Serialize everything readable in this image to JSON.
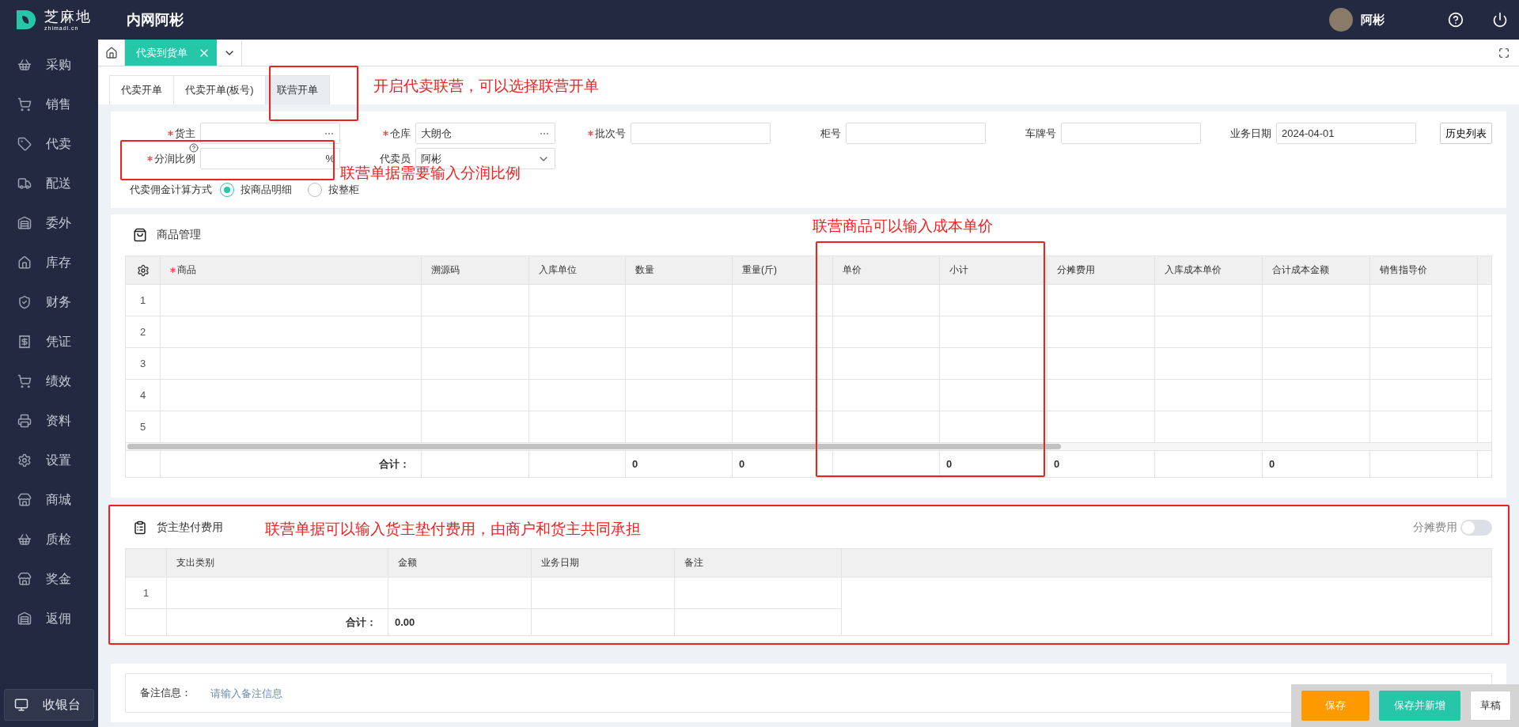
{
  "header": {
    "logo_text": "芝麻地",
    "logo_subtext": "zhimadi.cn",
    "title": "内网阿彬",
    "user": "阿彬"
  },
  "sidebar": {
    "items": [
      {
        "label": "采购"
      },
      {
        "label": "销售"
      },
      {
        "label": "代卖"
      },
      {
        "label": "配送"
      },
      {
        "label": "委外"
      },
      {
        "label": "库存"
      },
      {
        "label": "财务"
      },
      {
        "label": "凭证"
      },
      {
        "label": "绩效"
      },
      {
        "label": "资料"
      },
      {
        "label": "设置"
      },
      {
        "label": "商城"
      },
      {
        "label": "质检"
      },
      {
        "label": "奖金"
      },
      {
        "label": "返佣"
      }
    ],
    "cashier": "收银台"
  },
  "page_tabs": [
    {
      "label": "代卖到货单",
      "selected": true
    }
  ],
  "order_tabs": [
    {
      "label": "代卖开单",
      "selected": false
    },
    {
      "label": "代卖开单(板号)",
      "selected": false
    },
    {
      "label": "联营开单",
      "selected": true
    }
  ],
  "form": {
    "fields": [
      {
        "label": "货主",
        "required": true,
        "kind": "picker"
      },
      {
        "label": "仓库",
        "required": true,
        "kind": "picker",
        "value": "大朗仓"
      },
      {
        "label": "批次号",
        "required": true,
        "kind": "text"
      },
      {
        "label": "柜号",
        "required": false,
        "kind": "text"
      },
      {
        "label": "车牌号",
        "required": false,
        "kind": "text"
      },
      {
        "label": "业务日期",
        "required": false,
        "kind": "text",
        "value": "2024-04-01"
      },
      {
        "label": "分润比例",
        "required": true,
        "kind": "percent",
        "suffix": "%"
      },
      {
        "label": "代卖员",
        "required": false,
        "kind": "select",
        "value": "阿彬"
      }
    ],
    "history_button": "历史列表",
    "commission": {
      "label": "代卖佣金计算方式",
      "options": [
        {
          "label": "按商品明细",
          "selected": true
        },
        {
          "label": "按整柜",
          "selected": false
        }
      ]
    }
  },
  "goods": {
    "title": "商品管理",
    "columns": [
      {
        "label": "商品",
        "required": true,
        "total": "合计："
      },
      {
        "label": "溯源码"
      },
      {
        "label": "入库单位"
      },
      {
        "label": "数量",
        "total": "0"
      },
      {
        "label": "重量(斤)",
        "total": "0"
      },
      {
        "label": "单价"
      },
      {
        "label": "小计",
        "total": "0"
      },
      {
        "label": "分摊费用",
        "total": "0"
      },
      {
        "label": "入库成本单价"
      },
      {
        "label": "合计成本金额",
        "total": "0"
      },
      {
        "label": "销售指导价"
      }
    ],
    "rows": [
      "1",
      "2",
      "3",
      "4",
      "5"
    ]
  },
  "payments": {
    "title": "货主垫付费用",
    "split_toggle": {
      "label": "分摊费用",
      "on": false
    },
    "columns": [
      {
        "label": "支出类别",
        "total": "合计："
      },
      {
        "label": "金额",
        "total": "0.00"
      },
      {
        "label": "业务日期"
      },
      {
        "label": "备注"
      }
    ],
    "rows": [
      "1"
    ]
  },
  "remark": {
    "label": "备注信息：",
    "placeholder": "请输入备注信息"
  },
  "actions": [
    {
      "label": "保存",
      "kind": "primary"
    },
    {
      "label": "保存并新增",
      "kind": "secondary"
    },
    {
      "label": "草稿",
      "kind": "plain"
    }
  ],
  "annotations": [
    {
      "text": "开启代卖联营，可以选择联营开单"
    },
    {
      "text": "联营单据需要输入分润比例"
    },
    {
      "text": "联营商品可以输入成本单价"
    },
    {
      "text": "联营单据可以输入货主垫付费用，由商户和货主共同承担"
    }
  ]
}
